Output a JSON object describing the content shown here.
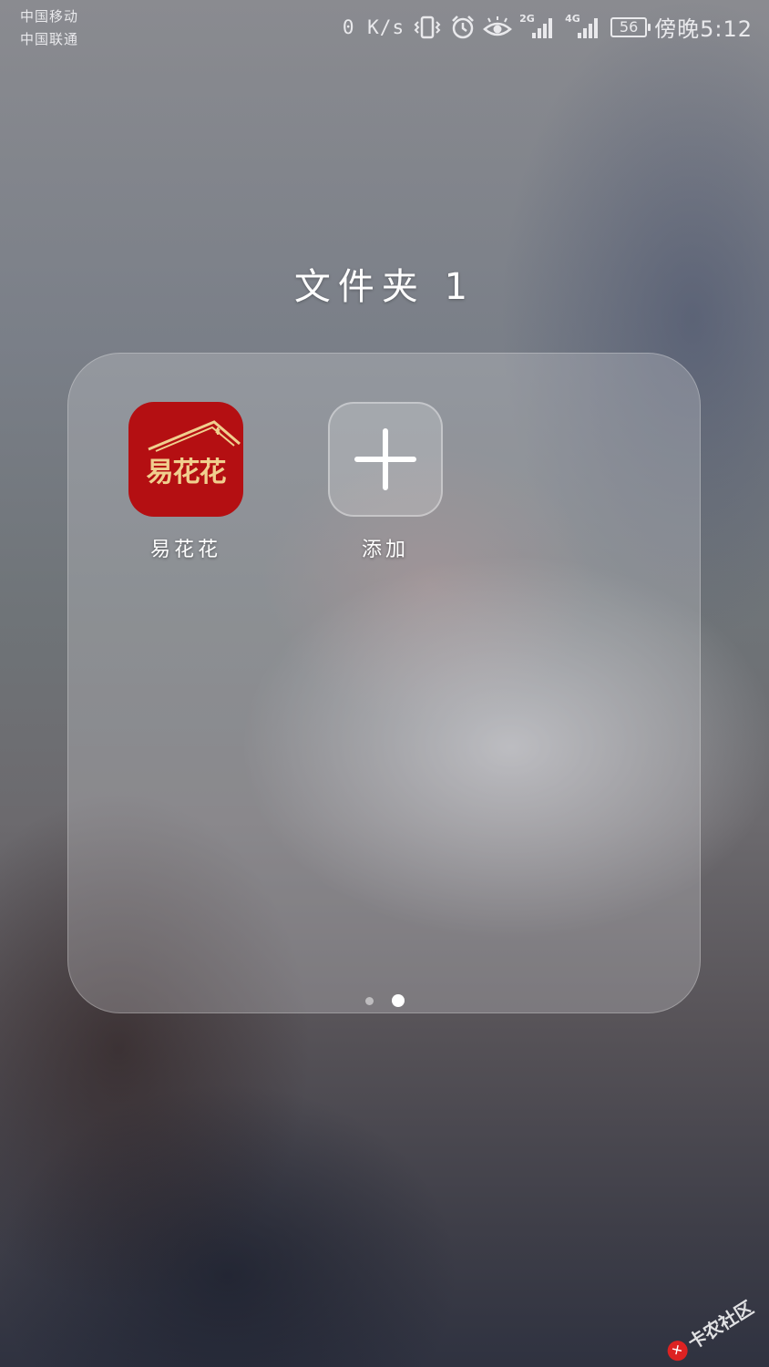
{
  "status_bar": {
    "carrier_1": "中国移动",
    "carrier_2": "中国联通",
    "net_speed": "0 K/s",
    "signal_1_label": "2G",
    "signal_2_label": "4G",
    "battery": "56",
    "time": "傍晚5:12",
    "icons": [
      "vibrate-icon",
      "alarm-icon",
      "eye-comfort-icon",
      "signal-icon",
      "signal-icon",
      "battery-icon"
    ]
  },
  "folder": {
    "title": "文件夹 1",
    "apps": [
      {
        "label": "易花花",
        "icon": "yihuahua-app-icon",
        "logo_text": "易花花",
        "color": "#b40f12"
      },
      {
        "label": "添加",
        "icon": "plus-icon"
      }
    ],
    "pages": 2,
    "current_page": 2
  },
  "watermark": {
    "text": "卡农社区"
  }
}
